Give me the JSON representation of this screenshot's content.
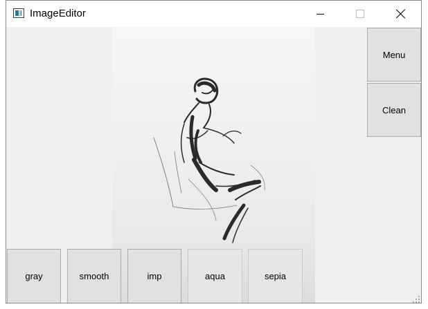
{
  "window": {
    "title": "ImageEditor",
    "icon": "image-editor-app-icon"
  },
  "titlebar_controls": {
    "minimize_icon": "minimize-icon",
    "maximize_icon": "maximize-icon",
    "close_icon": "close-icon"
  },
  "side_buttons": {
    "menu_label": "Menu",
    "clean_label": "Clean"
  },
  "filters": [
    {
      "label": "gray"
    },
    {
      "label": "smooth"
    },
    {
      "label": "imp"
    },
    {
      "label": "aqua"
    },
    {
      "label": "sepia"
    }
  ],
  "canvas": {
    "content": "pencil-sketch-image"
  }
}
